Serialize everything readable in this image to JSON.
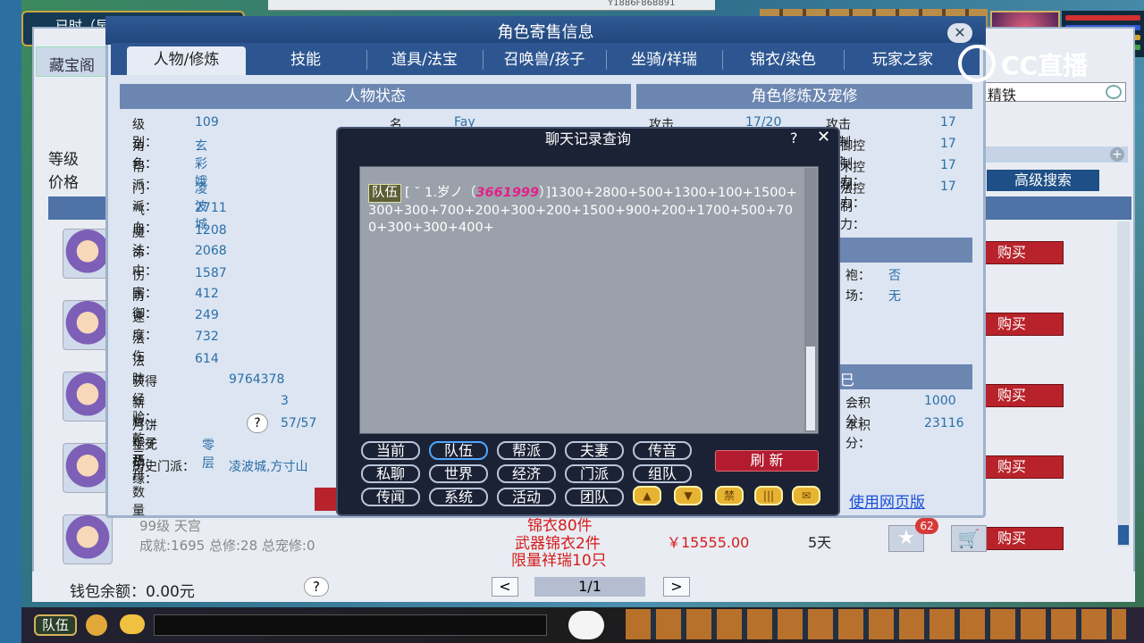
{
  "game": {
    "top_status": "已时（早",
    "top_strip_text": "Y1886F868891"
  },
  "market": {
    "left_tab": "藏宝阁",
    "search_value": "精铁",
    "level_label": "等级",
    "price_label": "价格",
    "adv_search_label": "高级搜索",
    "buy_label": "购买",
    "last_row": {
      "level_text": "99级 天宫",
      "stats_text": "成就:1695 总修:28 总宠修:0",
      "red_lines": [
        "锦衣80件",
        "武器锦衣2件",
        "限量祥瑞10只"
      ],
      "price": "￥15555.00",
      "days": "5天",
      "fav_count": "62"
    },
    "wallet_label": "钱包余额：0.00元",
    "help_label": "?",
    "page_prev": "<",
    "page_next": ">",
    "page_num": "1/1"
  },
  "role_window": {
    "title": "角色寄售信息",
    "close_label": "✕",
    "tabs": [
      "人物/修炼",
      "技能",
      "道具/法宝",
      "召唤兽/孩子",
      "坐骑/祥瑞",
      "锦衣/染色",
      "玩家之家"
    ],
    "left_head": "人物状态",
    "right_head": "角色修炼及宠修",
    "stats": [
      {
        "label": "级别：",
        "value": "109"
      },
      {
        "label": "角色：",
        "value": "玄彩娥"
      },
      {
        "label": "帮派：",
        "value": ""
      },
      {
        "label": "门派：",
        "value": "凌波城"
      },
      {
        "label": "气血：",
        "value": "2711"
      },
      {
        "label": "魔法：",
        "value": "1208"
      },
      {
        "label": "命中：",
        "value": "2068"
      },
      {
        "label": "伤害：",
        "value": "1587"
      },
      {
        "label": "防御：",
        "value": "412"
      },
      {
        "label": "速度：",
        "value": "249"
      },
      {
        "label": "法伤",
        "value": "732"
      },
      {
        "label": "法防",
        "value": "614"
      }
    ],
    "name_label": "名称：",
    "name_value": "Fay",
    "exp_label": "获得经验：",
    "exp_value": "9764378",
    "qianyuan_label": "新版乾元丹数量",
    "qianyuan_value": "3",
    "mooncake_label": "月饼粽子机缘：",
    "mooncake_value": "57/57",
    "shengsi_label": "生死劫：",
    "shengsi_value": "零层",
    "history_label": "历史门派：",
    "history_value": "凌波城,方寸山",
    "right_rows": [
      {
        "label": "攻击修炼：",
        "value": "17/20",
        "label2": "攻击控制力：",
        "value2": "17"
      },
      {
        "label": "",
        "value": "",
        "label2": "御控制力：",
        "value2": "17"
      },
      {
        "label": "",
        "value": "",
        "label2": "术控制力：",
        "value2": "17"
      },
      {
        "label": "",
        "value": "",
        "label2": "法控制力：",
        "value2": "17"
      }
    ],
    "right_mid": [
      {
        "label": "袍：",
        "value": "否"
      },
      {
        "label": "场：",
        "value": "无"
      }
    ],
    "right_low": [
      {
        "label": "会积分：",
        "value": "1000"
      },
      {
        "label": "本积分：",
        "value": "23116"
      }
    ],
    "section_char": "巳"
  },
  "chat_dialog": {
    "title": "聊天记录查询",
    "help_label": "?",
    "close_label": "✕",
    "message": {
      "channel": "队伍",
      "sender_prefix": "[ ˘ 1.岁ノ（",
      "sender_number": "3661999",
      "sender_suffix": "）]",
      "content": "1300+2800+500+1300+100+1500+300+300+700+200+300+200+1500+900+200+1700+500+700+300+300+400+"
    },
    "channels": [
      "当前",
      "队伍",
      "帮派",
      "夫妻",
      "传音",
      "私聊",
      "世界",
      "经济",
      "门派",
      "组队",
      "传闻",
      "系统",
      "活动",
      "团队"
    ],
    "active_channel": "队伍",
    "refresh_label": "刷 新",
    "emo_labels": [
      "▲",
      "▼",
      "禁",
      "|||",
      "✉"
    ],
    "web_link": "使用网页版"
  },
  "watermark": {
    "text": "CC直播"
  },
  "bottom_bar": {
    "team_label": "队伍"
  },
  "colors": {
    "accent_red": "#b8232b",
    "title_blue": "#2f5a94",
    "link_blue": "#1c4fd9"
  }
}
